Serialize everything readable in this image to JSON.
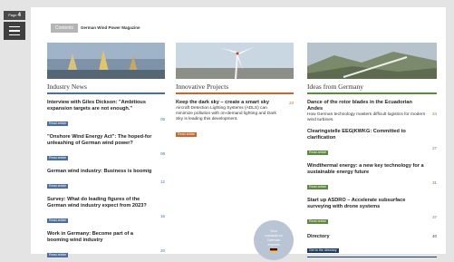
{
  "nav": {
    "page_prefix": "Page",
    "page_number": "4"
  },
  "header": {
    "contents_label": "Contents",
    "magazine_title": "German Wind Power Magazine"
  },
  "columns": [
    {
      "heading": "Industry News",
      "articles": [
        {
          "title": "Interview with Giles Dickson: \"Ambitious expansion targets are not enough.\"",
          "desc": "",
          "page": "05",
          "button": "Read article"
        },
        {
          "title": "\"Onshore Wind Energy Act\": The hoped-for unleashing of German wind power?",
          "desc": "",
          "page": "08",
          "button": "Read article"
        },
        {
          "title": "German wind industry: Business is boomig",
          "desc": "",
          "page": "12",
          "button": "Read article"
        },
        {
          "title": "Survey: What do leading figures of the German wind industry expect from 2023?",
          "desc": "",
          "page": "16",
          "button": "Read article"
        },
        {
          "title": "Work in Germany: Become part of a booming wind industry",
          "desc": "",
          "page": "20",
          "button": "Read article"
        }
      ]
    },
    {
      "heading": "Innovative Projects",
      "articles": [
        {
          "title": "Keep the dark sky – create a smart sky",
          "desc": "Aircraft Detection Lighting Systems (ADLS) can minimize pollution with on-demand lighting and Dark Sky is leading this development.",
          "page": "23",
          "button": "Read article"
        }
      ]
    },
    {
      "heading": "Ideas from Germany",
      "articles": [
        {
          "title": "Dance of the rotor blades in the Ecuadorian Andes",
          "desc": "How German technology masters difficult logistics for modern wind turbines.",
          "page": "24",
          "button": ""
        },
        {
          "title": "Clearingstelle EEG|KWKG: Committed to clarification",
          "desc": "",
          "page": "27",
          "button": "Read article"
        },
        {
          "title": "Windthermal energy: a new key technology for a sustainable energy future",
          "desc": "",
          "page": "31",
          "button": "Read article"
        },
        {
          "title": "Start up ASDRO – Accelerate subsurface surveying with drone systems",
          "desc": "",
          "page": "37",
          "button": "Read article"
        }
      ]
    }
  ],
  "directory": {
    "title": "Directory",
    "page": "40",
    "button": "Get to the directory"
  },
  "contacts": {
    "line1": "Your",
    "line2": "contacts to",
    "line3": "German",
    "line4": "experts"
  }
}
